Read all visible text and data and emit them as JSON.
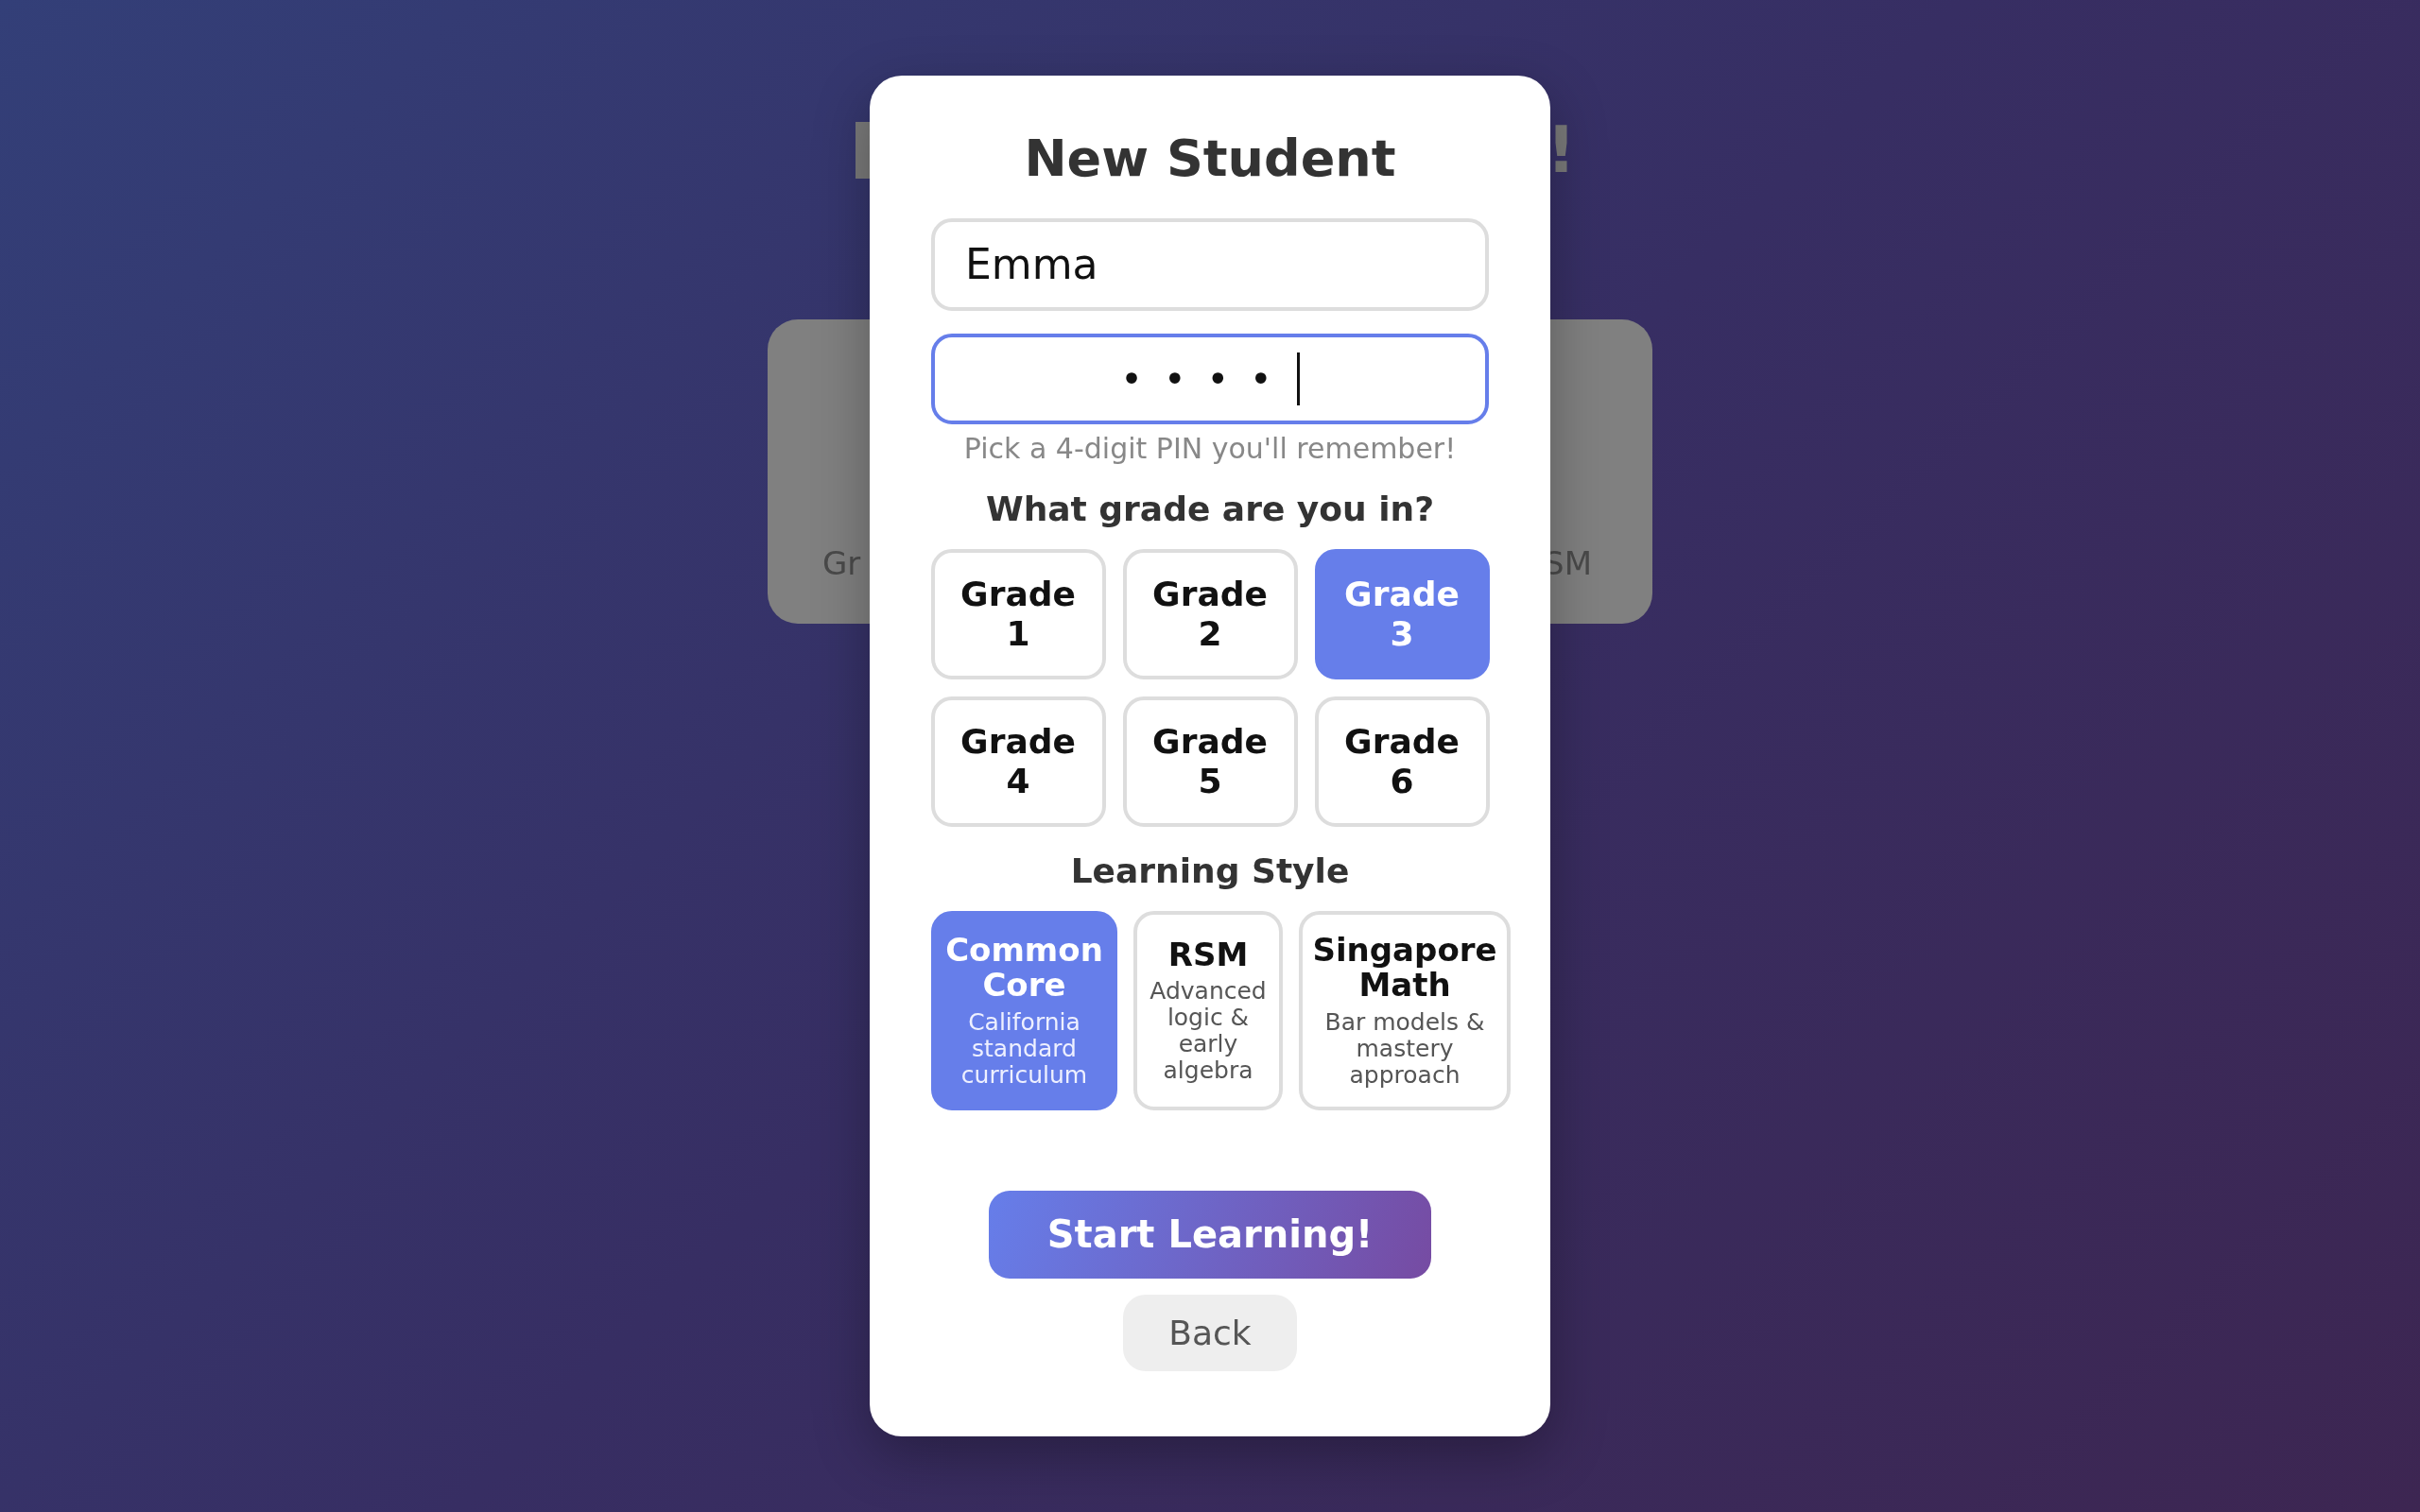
{
  "background": {
    "heading_end": "!",
    "card": {
      "left_text": "Gr",
      "right_text": "SM"
    }
  },
  "dialog": {
    "title": "New Student",
    "name_field": {
      "value": "Emma"
    },
    "pin_field": {
      "value": "••••",
      "focused": true
    },
    "pin_hint": "Pick a 4-digit PIN you'll remember!",
    "grade_question": "What grade are you in?",
    "grades": [
      {
        "label": "Grade 1",
        "selected": false
      },
      {
        "label": "Grade 2",
        "selected": false
      },
      {
        "label": "Grade 3",
        "selected": true
      },
      {
        "label": "Grade 4",
        "selected": false
      },
      {
        "label": "Grade 5",
        "selected": false
      },
      {
        "label": "Grade 6",
        "selected": false
      }
    ],
    "style_heading": "Learning Style",
    "styles": [
      {
        "name": "Common Core",
        "description": "California standard curriculum",
        "selected": true
      },
      {
        "name": "RSM",
        "description": "Advanced logic & early algebra",
        "selected": false
      },
      {
        "name": "Singapore Math",
        "description": "Bar models & mastery approach",
        "selected": false
      }
    ],
    "start_button": "Start Learning!",
    "back_button": "Back"
  }
}
